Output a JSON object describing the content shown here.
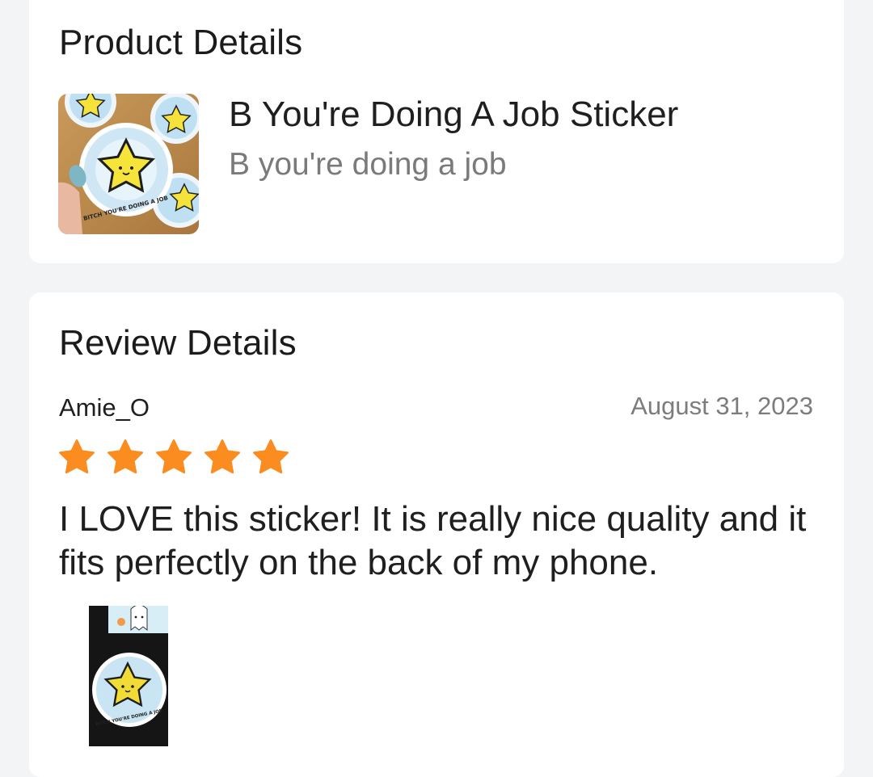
{
  "product_section": {
    "title": "Product Details",
    "product_name": "B You're Doing A Job Sticker",
    "variant": "B you're doing a job",
    "thumbnail": {
      "sticker_text": "BITCH YOU'RE DOING A JOB"
    }
  },
  "review_section": {
    "title": "Review Details",
    "reviewer": "Amie_O",
    "date": "August 31, 2023",
    "rating": 5,
    "rating_max": 5,
    "text": "I LOVE this sticker! It is really nice quality and it fits perfectly on the back of my phone.",
    "photo": {
      "sticker_text": "BITCH YOU'RE DOING A JOB"
    }
  },
  "colors": {
    "star": "#fb8c1f",
    "background": "#f3f4f6",
    "card": "#ffffff",
    "primary_text": "#1f1f1f",
    "secondary_text": "#7a7a7a"
  },
  "icons": {
    "rating_star": "star-icon"
  }
}
